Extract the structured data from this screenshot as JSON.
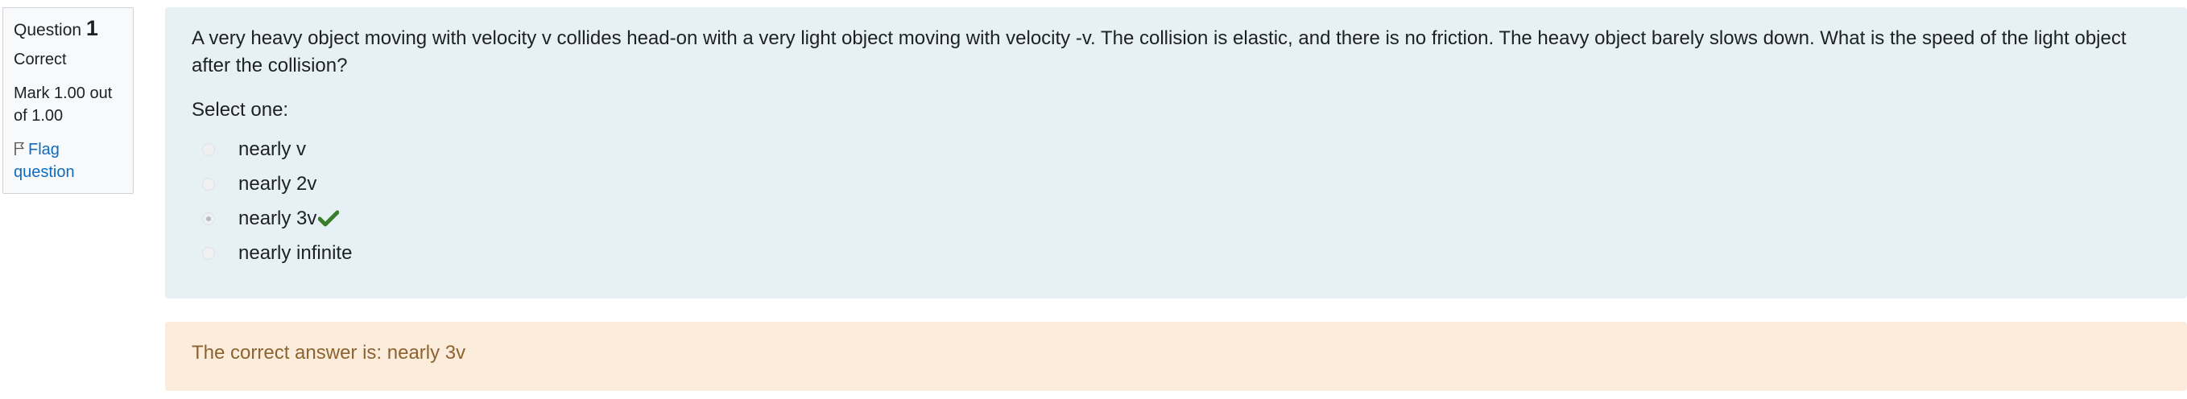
{
  "info": {
    "question_word": "Question",
    "question_number": "1",
    "state": "Correct",
    "grade": "Mark 1.00 out of 1.00",
    "flag_label": "Flag question"
  },
  "question": {
    "text": "A very heavy object moving with velocity v collides head-on with a very light object moving with velocity -v. The collision is elastic, and there is no friction. The heavy object barely slows down. What is the speed of the light object after the collision?",
    "prompt": "Select one:",
    "options": [
      {
        "label": "nearly v",
        "selected": false
      },
      {
        "label": "nearly 2v",
        "selected": false
      },
      {
        "label": "nearly 3v",
        "selected": true
      },
      {
        "label": "nearly infinite",
        "selected": false
      }
    ]
  },
  "feedback": {
    "right_answer": "The correct answer is: nearly 3v"
  },
  "colors": {
    "formulation_bg": "#e7f0f4",
    "outcome_bg": "#fbecdc",
    "outcome_text": "#8d6330",
    "correct_tick": "#3a7d2b",
    "link": "#0f6cbf"
  },
  "icons": {
    "flag": "flag-icon",
    "correct": "check-icon"
  }
}
